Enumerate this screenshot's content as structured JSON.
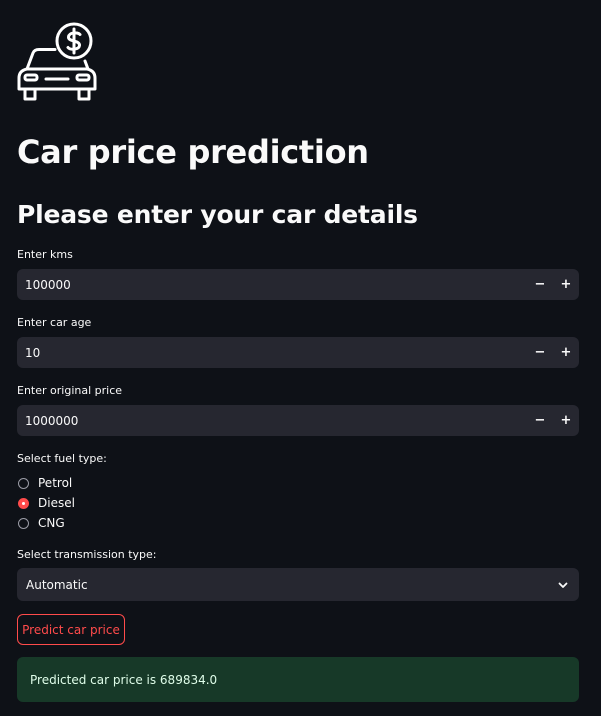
{
  "header": {
    "logo_icon": "car-price-icon",
    "title": "Car price prediction",
    "subtitle": "Please enter your car details"
  },
  "form": {
    "kms": {
      "label": "Enter kms",
      "value": "100000",
      "decrement": "−",
      "increment": "+"
    },
    "car_age": {
      "label": "Enter car age",
      "value": "10",
      "decrement": "−",
      "increment": "+"
    },
    "original_price": {
      "label": "Enter original price",
      "value": "1000000",
      "decrement": "−",
      "increment": "+"
    },
    "fuel_type": {
      "label": "Select fuel type:",
      "options": [
        "Petrol",
        "Diesel",
        "CNG"
      ],
      "selected": "Diesel"
    },
    "transmission": {
      "label": "Select transmission type:",
      "value": "Automatic",
      "icon": "chevron-down-icon"
    },
    "submit_label": "Predict car price"
  },
  "result": {
    "text": "Predicted car price is 689834.0"
  },
  "colors": {
    "background": "#0e1117",
    "input_bg": "#262730",
    "accent": "#ff4b4b",
    "success_bg": "#173928",
    "success_text": "#dffde9"
  }
}
